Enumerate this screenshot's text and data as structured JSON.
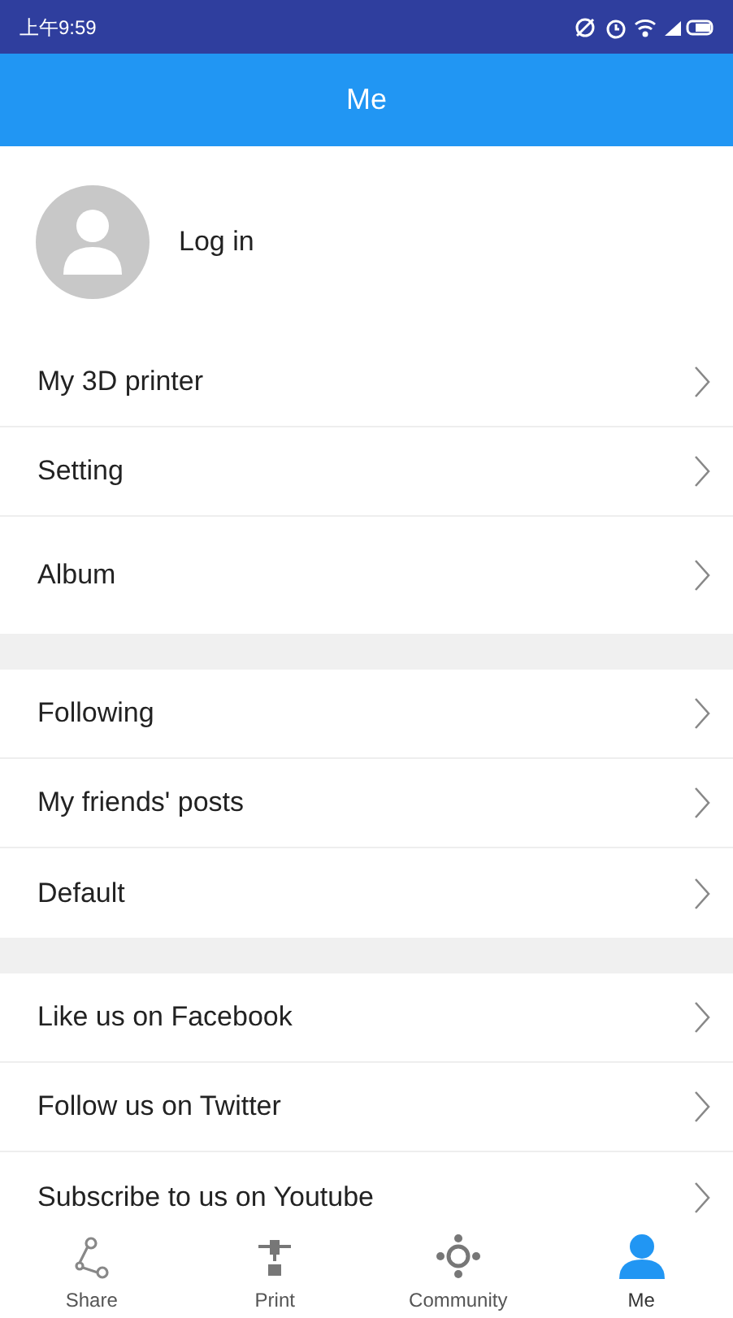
{
  "status_bar": {
    "time": "上午9:59"
  },
  "header": {
    "title": "Me"
  },
  "profile": {
    "label": "Log in"
  },
  "sections": [
    {
      "items": [
        {
          "label": "My 3D printer"
        },
        {
          "label": "Setting"
        },
        {
          "label": "Album"
        }
      ]
    },
    {
      "items": [
        {
          "label": "Following"
        },
        {
          "label": "My friends' posts"
        },
        {
          "label": "Default"
        }
      ]
    },
    {
      "items": [
        {
          "label": "Like us on Facebook"
        },
        {
          "label": "Follow us on Twitter"
        },
        {
          "label": "Subscribe to us on Youtube"
        }
      ]
    }
  ],
  "tabs": [
    {
      "kind": "share",
      "label": "Share",
      "selected": false
    },
    {
      "kind": "print",
      "label": "Print",
      "selected": false
    },
    {
      "kind": "community",
      "label": "Community",
      "selected": false
    },
    {
      "kind": "me",
      "label": "Me",
      "selected": true
    }
  ]
}
